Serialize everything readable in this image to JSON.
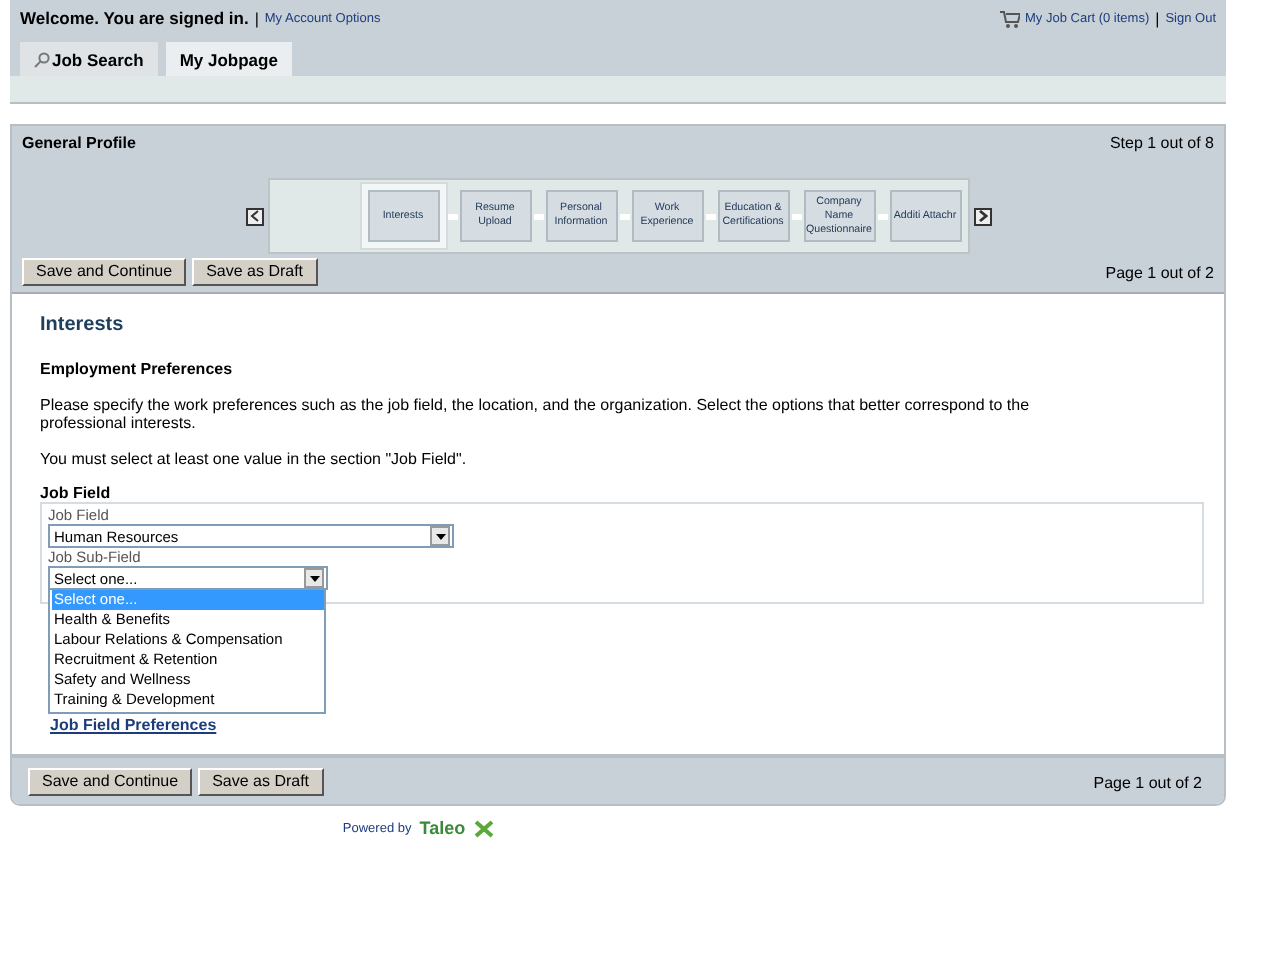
{
  "header": {
    "welcome": "Welcome. You are signed in.",
    "separator_left": "|",
    "account_link": "My Account Options",
    "cart_link": "My Job Cart (0 items)",
    "separator_right": "|",
    "sign_out": "Sign Out"
  },
  "tabs": [
    {
      "label": "Job Search",
      "selected": false
    },
    {
      "label": "My Jobpage",
      "selected": true
    }
  ],
  "panel": {
    "title": "General Profile",
    "step": "Step 1 out of 8",
    "steps": [
      {
        "label": "Interests",
        "selected": true
      },
      {
        "label": "Resume Upload",
        "selected": false
      },
      {
        "label": "Personal Information",
        "selected": false
      },
      {
        "label": "Work Experience",
        "selected": false
      },
      {
        "label": "Education & Certifications",
        "selected": false
      },
      {
        "label": "Company Name Questionnaire",
        "selected": false
      },
      {
        "label": "Additi Attachr",
        "selected": false
      }
    ],
    "buttons": [
      "Save and Continue",
      "Save as Draft"
    ],
    "page": "Page 1 out of 2"
  },
  "content": {
    "heading": "Interests",
    "subheading": "Employment Preferences",
    "intro": "Please specify the work preferences such as the job field, the location, and the organization. Select the options that better correspond to the professional interests.",
    "note": "You must select at least one value in the section \"Job Field\".",
    "section": "Job Field",
    "job_field": {
      "label": "Job Field",
      "value": "Human Resources"
    },
    "sub_field": {
      "label": "Job Sub-Field",
      "value": "Select one...",
      "expanded": true,
      "options": [
        {
          "label": "Select one...",
          "selected": true
        },
        {
          "label": "Health & Benefits",
          "selected": false
        },
        {
          "label": "Labour Relations & Compensation",
          "selected": false
        },
        {
          "label": "Recruitment & Retention",
          "selected": false
        },
        {
          "label": "Safety and Wellness",
          "selected": false
        },
        {
          "label": "Training & Development",
          "selected": false
        }
      ]
    },
    "link": "Job Field Preferences"
  },
  "footer": {
    "buttons": [
      "Save and Continue",
      "Save as Draft"
    ],
    "page": "Page 1 out of 2"
  },
  "powered": {
    "text": "Powered by",
    "brand": "Taleo"
  }
}
